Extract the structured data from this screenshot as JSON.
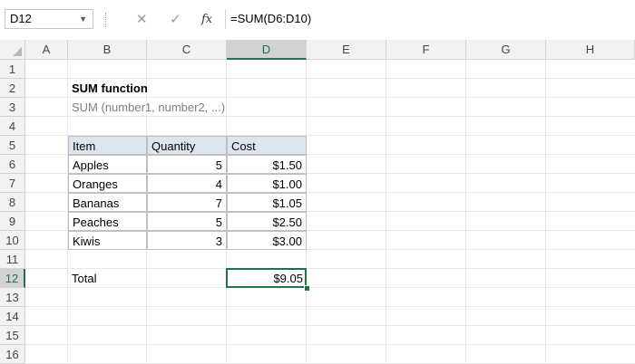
{
  "formula_bar": {
    "name_box": "D12",
    "formula": "=SUM(D6:D10)",
    "fx_label": "fx",
    "cancel_icon": "✕",
    "enter_icon": "✓"
  },
  "columns": [
    "A",
    "B",
    "C",
    "D",
    "E",
    "F",
    "G",
    "H"
  ],
  "rows": [
    "1",
    "2",
    "3",
    "4",
    "5",
    "6",
    "7",
    "8",
    "9",
    "10",
    "11",
    "12",
    "13",
    "14",
    "15",
    "16"
  ],
  "sheet": {
    "title": "SUM function",
    "subtitle": "SUM (number1, number2, ...)",
    "table": {
      "headers": [
        "Item",
        "Quantity",
        "Cost"
      ],
      "rows": [
        [
          "Apples",
          "5",
          "$1.50"
        ],
        [
          "Oranges",
          "4",
          "$1.00"
        ],
        [
          "Bananas",
          "7",
          "$1.05"
        ],
        [
          "Peaches",
          "5",
          "$2.50"
        ],
        [
          "Kiwis",
          "3",
          "$3.00"
        ]
      ]
    },
    "total_label": "Total",
    "total_value": "$9.05"
  },
  "colors": {
    "selection": "#217346",
    "header_fill": "#dce6f1"
  }
}
